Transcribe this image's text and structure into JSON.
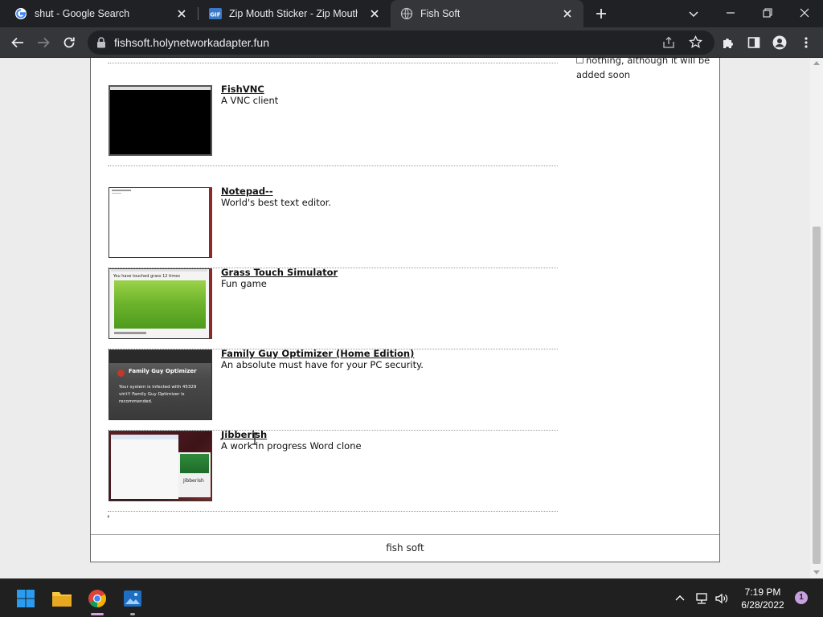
{
  "browser": {
    "tabs": [
      {
        "title": "shut - Google Search",
        "favicon": "google-icon",
        "active": false
      },
      {
        "title": "Zip Mouth Sticker - Zip Mouth Sticker",
        "favicon": "gif-icon",
        "active": false
      },
      {
        "title": "Fish Soft",
        "favicon": "globe-icon",
        "active": true
      }
    ],
    "url": "fishsoft.holynetworkadapter.fun"
  },
  "page": {
    "sidebar_note": "nothing, although it will be added soon",
    "items": [
      {
        "title": "FishVNC",
        "description": "A VNC client",
        "thumb": "black-screen"
      },
      {
        "title": "Notepad--",
        "description": "World's best text editor.",
        "thumb": "blank-window"
      },
      {
        "title": "Grass Touch Simulator",
        "description": "Fun game",
        "thumb": "grass-photo",
        "thumb_caption": "You have touched grass 12 times"
      },
      {
        "title": "Family Guy Optimizer (Home Edition)",
        "description": "An absolute must have for your PC security.",
        "thumb": "fake-alert",
        "thumb_title": "Family Guy Optimizer",
        "thumb_text": "Your system is infected with 45329 virii!! Family Guy Optimizer is recommended."
      },
      {
        "title": "Jibberish",
        "description": "A work in progress Word clone",
        "thumb": "word-clone",
        "thumb_label": "Jibberish"
      }
    ],
    "trailing_text": ",",
    "footer": "fish soft"
  },
  "taskbar": {
    "time": "7:19 PM",
    "date": "6/28/2022",
    "notification_count": "1"
  },
  "colors": {
    "chrome_dark": "#202124",
    "chrome_toolbar": "#35363a",
    "taskbar": "#202020",
    "page_bg": "#ececec"
  }
}
